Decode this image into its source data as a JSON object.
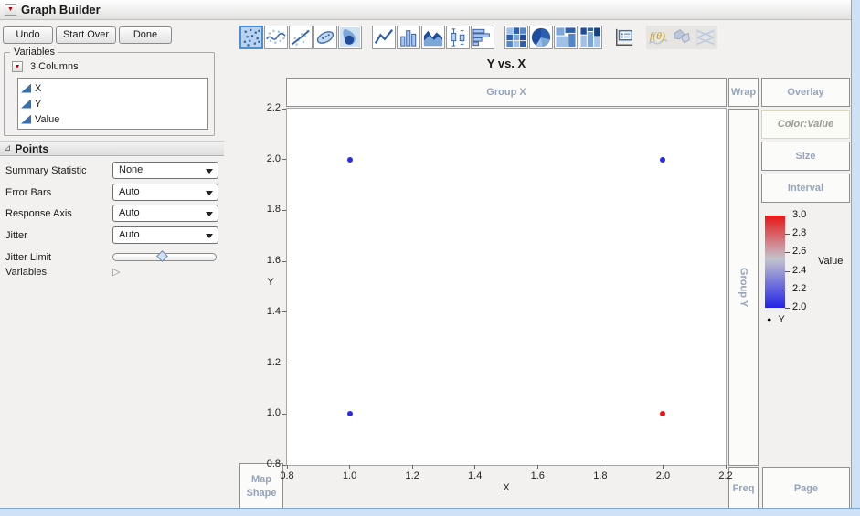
{
  "window": {
    "title": "Graph Builder"
  },
  "toolbar": {
    "buttons": [
      {
        "label": "Undo"
      },
      {
        "label": "Start Over"
      },
      {
        "label": "Done"
      }
    ],
    "icons": [
      {
        "name": "points-icon",
        "selected": true
      },
      {
        "name": "smoother-icon"
      },
      {
        "name": "line-of-fit-icon"
      },
      {
        "name": "ellipse-icon"
      },
      {
        "name": "contour-icon"
      },
      {
        "name": "line-chart-icon",
        "gap": true
      },
      {
        "name": "bar-chart-icon"
      },
      {
        "name": "area-chart-icon"
      },
      {
        "name": "box-plot-icon"
      },
      {
        "name": "histogram-icon"
      },
      {
        "name": "heatmap-icon",
        "gap": true
      },
      {
        "name": "pie-chart-icon"
      },
      {
        "name": "treemap-icon"
      },
      {
        "name": "mosaic-icon"
      },
      {
        "name": "caption-box-icon",
        "gap": true,
        "bare": true
      },
      {
        "name": "formula-icon",
        "disabled": true,
        "gap": true
      },
      {
        "name": "map-shape-icon",
        "disabled": true
      },
      {
        "name": "parallel-plot-icon",
        "disabled": true
      }
    ]
  },
  "variables_panel": {
    "title": "Variables",
    "columns_header": "3 Columns",
    "columns": [
      "X",
      "Y",
      "Value"
    ]
  },
  "points_panel": {
    "title": "Points",
    "rows": [
      {
        "label": "Summary Statistic",
        "value": "None"
      },
      {
        "label": "Error Bars",
        "value": "Auto"
      },
      {
        "label": "Response Axis",
        "value": "Auto"
      },
      {
        "label": "Jitter",
        "value": "Auto"
      }
    ],
    "jitter_limit_label": "Jitter Limit",
    "variables_label": "Variables"
  },
  "graph": {
    "zones": {
      "group_x": "Group X",
      "wrap": "Wrap",
      "overlay": "Overlay",
      "color": "Color:Value",
      "size": "Size",
      "interval": "Interval",
      "group_y": "Group Y",
      "map_shape": "Map Shape",
      "freq": "Freq",
      "page": "Page"
    }
  },
  "chart_data": {
    "type": "scatter",
    "title": "Y vs. X",
    "xlabel": "X",
    "ylabel": "Y",
    "xlim": [
      0.8,
      2.2
    ],
    "ylim": [
      0.8,
      2.2
    ],
    "x_ticks": [
      0.8,
      1.0,
      1.2,
      1.4,
      1.6,
      1.8,
      2.0,
      2.2
    ],
    "y_ticks": [
      0.8,
      1.0,
      1.2,
      1.4,
      1.6,
      1.8,
      2.0,
      2.2
    ],
    "grid": false,
    "points": [
      {
        "x": 1.0,
        "y": 2.0,
        "value": 2.0,
        "color": "#2a2ae8"
      },
      {
        "x": 2.0,
        "y": 2.0,
        "value": 2.0,
        "color": "#2a2ae8"
      },
      {
        "x": 1.0,
        "y": 1.0,
        "value": 2.0,
        "color": "#2a2ae8"
      },
      {
        "x": 2.0,
        "y": 1.0,
        "value": 3.0,
        "color": "#ee1414"
      }
    ],
    "color_legend": {
      "label": "Value",
      "min": 2.0,
      "max": 3.0,
      "ticks": [
        3.0,
        2.8,
        2.6,
        2.4,
        2.2,
        2.0
      ],
      "top_color": "#e81515",
      "mid_color": "#c4c3cd",
      "bottom_color": "#2222e8"
    },
    "series_legend": [
      {
        "marker": "●",
        "label": "Y",
        "color": "#000000"
      }
    ]
  }
}
